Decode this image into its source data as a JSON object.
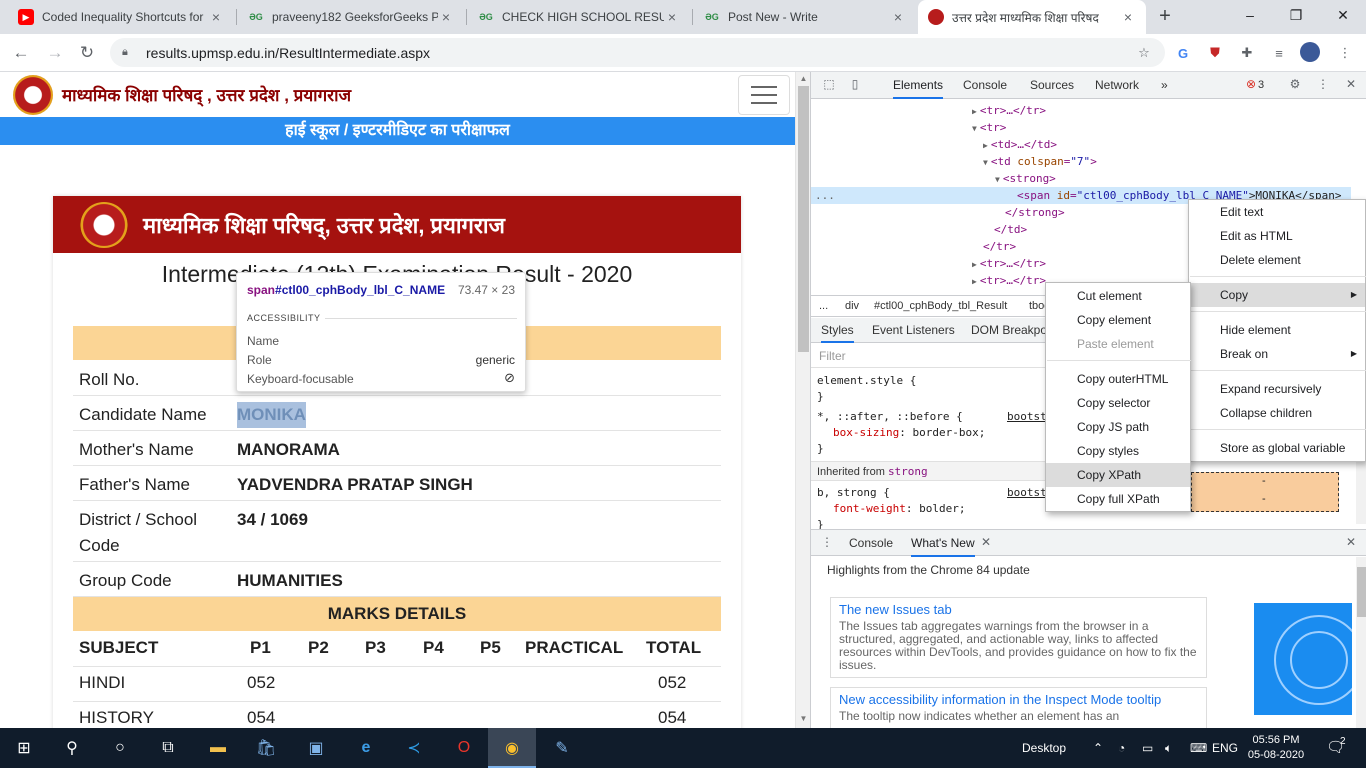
{
  "browser": {
    "tabs": [
      {
        "title": "Coded Inequality Shortcuts for",
        "icon": "youtube-icon"
      },
      {
        "title": "praveeny182 GeeksforGeeks P",
        "icon": "gfg-icon"
      },
      {
        "title": "CHECK HIGH SCHOOL RESULT",
        "icon": "gfg-icon"
      },
      {
        "title": "Post New - Write",
        "icon": "gfg-icon"
      },
      {
        "title": "उत्तर प्रदेश माध्यमिक शिक्षा परिषद",
        "icon": "seal-icon"
      }
    ],
    "new_tab": "+",
    "url": "results.upmsp.edu.in/ResultIntermediate.aspx"
  },
  "page": {
    "site_title": "माध्यमिक शिक्षा परिषद् , उत्तर प्रदेश , प्रयागराज",
    "banner": "हाई स्कूल / इण्टरमीडिएट का परीक्षाफल",
    "card_title": "माध्यमिक शिक्षा परिषद्, उत्तर प्रदेश, प्रयागराज",
    "card_subtitle": "Intermediate (12th) Examination Result - 2020",
    "details": [
      {
        "label": "Roll No.",
        "value": ""
      },
      {
        "label": "Candidate Name",
        "value": "MONIKA"
      },
      {
        "label": "Mother's Name",
        "value": "MANORAMA"
      },
      {
        "label": "Father's Name",
        "value": "YADVENDRA PRATAP SINGH"
      },
      {
        "label": "District / School Code",
        "value": "34 / 1069"
      },
      {
        "label": "Group Code",
        "value": "HUMANITIES"
      }
    ],
    "marks_title": "MARKS DETAILS",
    "marks_headers": [
      "SUBJECT",
      "P1",
      "P2",
      "P3",
      "P4",
      "P5",
      "PRACTICAL",
      "TOTAL"
    ],
    "marks_rows": [
      {
        "subject": "HINDI",
        "p1": "052",
        "total": "052"
      },
      {
        "subject": "HISTORY",
        "p1": "054",
        "total": "054"
      }
    ]
  },
  "tooltip": {
    "selector_tag": "span",
    "selector_id": "#ctl00_cphBody_lbl_C_NAME",
    "dims": "73.47 × 23",
    "section": "ACCESSIBILITY",
    "rows": [
      {
        "key": "Name",
        "value": ""
      },
      {
        "key": "Role",
        "value": "generic"
      },
      {
        "key": "Keyboard-focusable",
        "value": ""
      }
    ]
  },
  "devtools": {
    "tabs": [
      "Elements",
      "Console",
      "Sources",
      "Network",
      "»"
    ],
    "error_count": "3",
    "dom": {
      "l1": "<tr>…</tr>",
      "l2": "<tr>",
      "l3": "<td>…</td>",
      "l4_tag": "<td ",
      "l4_attr": "colspan",
      "l4_val": "\"7\"",
      "l4_end": ">",
      "l5": "<strong>",
      "l6_tag": "<span ",
      "l6_attr": "id",
      "l6_val": "\"ctl00_cphBody_lbl_C_NAME\"",
      "l6_rest": ">MONIKA</span>",
      "l7": "</strong>",
      "l8": "</td>",
      "l9": "</tr>",
      "l10": "<tr>…</tr>",
      "l11": "<tr>…</tr>",
      "ellipsis": "..."
    },
    "breadcrumbs": [
      "...",
      "div",
      "#ctl00_cphBody_tbl_Result",
      "tbody"
    ],
    "styles_tabs": [
      "Styles",
      "Event Listeners",
      "DOM Breakpoints"
    ],
    "filter_placeholder": "Filter",
    "element_style": "element.style {",
    "brace_close": "}",
    "rule2_selector": "*, ::after, ::before {",
    "rule2_source": "bootstrap",
    "rule2_prop": "box-sizing",
    "rule2_val": "border-box;",
    "inherited_label": "Inherited from",
    "inherited_tag": "strong",
    "rule3_selector": "b, strong {",
    "rule3_source": "bootstrap",
    "rule3_prop": "font-weight",
    "rule3_val": "bolder;",
    "boxmodel_values": [
      "-",
      "-"
    ],
    "drawer_tabs": [
      "Console",
      "What's New"
    ],
    "drawer_heading": "Highlights from the Chrome 84 update",
    "news": [
      {
        "title": "The new Issues tab",
        "body": "The Issues tab aggregates warnings from the browser in a structured, aggregated, and actionable way, links to affected resources within DevTools, and provides guidance on how to fix the issues."
      },
      {
        "title": "New accessibility information in the Inspect Mode tooltip",
        "body": "The tooltip now indicates whether an element has an"
      }
    ]
  },
  "context_menu": {
    "items": [
      "Edit text",
      "Edit as HTML",
      "Delete element",
      "Copy",
      "Hide element",
      "Break on",
      "Expand recursively",
      "Collapse children",
      "Store as global variable"
    ]
  },
  "copy_submenu": {
    "items": [
      "Cut element",
      "Copy element",
      "Paste element",
      "Copy outerHTML",
      "Copy selector",
      "Copy JS path",
      "Copy styles",
      "Copy XPath",
      "Copy full XPath"
    ],
    "highlighted": "Copy XPath"
  },
  "taskbar": {
    "desktop_label": "Desktop",
    "language": "ENG",
    "time": "05:56 PM",
    "date": "05-08-2020",
    "notification_count": "2"
  }
}
